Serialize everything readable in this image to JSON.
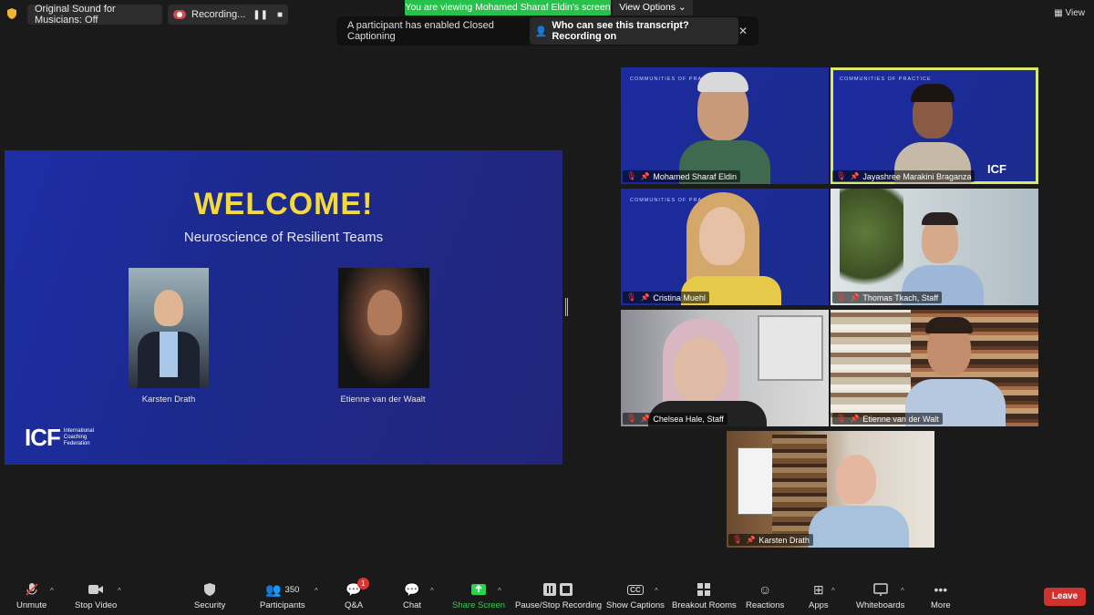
{
  "top": {
    "sound_label": "Original Sound for Musicians: Off",
    "recording_label": "Recording...",
    "viewing_banner": "You are viewing Mohamed Sharaf Eldin's screen",
    "view_options": "View Options",
    "view_label": "View"
  },
  "captions_banner": {
    "message": "A participant has enabled Closed Captioning",
    "who_label": "Who can see this transcript? Recording on"
  },
  "slide": {
    "title": "WELCOME!",
    "subtitle": "Neuroscience of Resilient Teams",
    "presenter1": "Karsten Drath",
    "presenter2": "Etienne van der Waalt",
    "logo_mark": "ICF",
    "logo_text_1": "International",
    "logo_text_2": "Coaching",
    "logo_text_3": "Federation"
  },
  "tiles": {
    "cop_label": "COMMUNITIES OF PRACTICE",
    "t1": "Mohamed Sharaf Eldin",
    "t2": "Jayashree Marakini Braganza",
    "t3": "Cristina Muehl",
    "t4": "Thomas Tkach, Staff",
    "t5": "Chelsea Hale, Staff",
    "t6": "Etienne van der Walt",
    "t7": "Karsten Drath"
  },
  "toolbar": {
    "unmute": "Unmute",
    "stop_video": "Stop Video",
    "security": "Security",
    "participants": "Participants",
    "participants_count": "350",
    "qa": "Q&A",
    "qa_badge": "1",
    "chat": "Chat",
    "share_screen": "Share Screen",
    "pause_recording": "Pause/Stop Recording",
    "show_captions": "Show Captions",
    "breakout_rooms": "Breakout Rooms",
    "reactions": "Reactions",
    "apps": "Apps",
    "whiteboards": "Whiteboards",
    "more": "More",
    "leave": "Leave"
  },
  "colors": {
    "accent_green": "#27c24c",
    "slide_title": "#f4da3c",
    "leave_red": "#d2322d",
    "active_speaker": "#d8e96a"
  }
}
